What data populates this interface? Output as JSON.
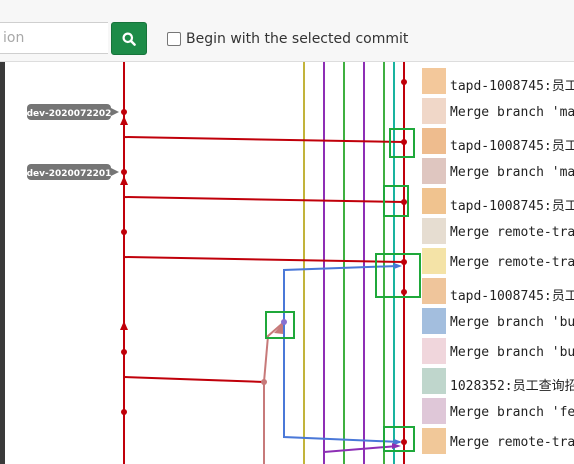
{
  "toolbar": {
    "search_placeholder": "ion",
    "search_button_icon": "search-icon",
    "checkbox_label": "Begin with the selected commit",
    "checkbox_checked": false
  },
  "branch_tags": [
    {
      "label": "dev-2020072202"
    },
    {
      "label": "dev-2020072201"
    }
  ],
  "colors": {
    "accent": "#1d8b48",
    "main_line": "#c0000a",
    "olive_line": "#c2b43a",
    "purple_line": "#8d2fb5",
    "green_line": "#3fb03f",
    "teal_line": "#19b3a0",
    "blue_line": "#4a78d8",
    "pink_line": "#c77a7a",
    "highlight_box": "#1fa83a",
    "tag_bg": "#757575"
  },
  "commit_messages": [
    "tapd-1008745:员工",
    "Merge branch 'ma",
    "tapd-1008745:员工",
    "Merge branch 'ma",
    "tapd-1008745:员工",
    "Merge remote-trac",
    "Merge remote-trac",
    "tapd-1008745:员工",
    "Merge branch 'bug",
    "Merge branch 'bug",
    "1028352:员工查询招",
    "Merge branch 'fea",
    "Merge remote-trac"
  ]
}
